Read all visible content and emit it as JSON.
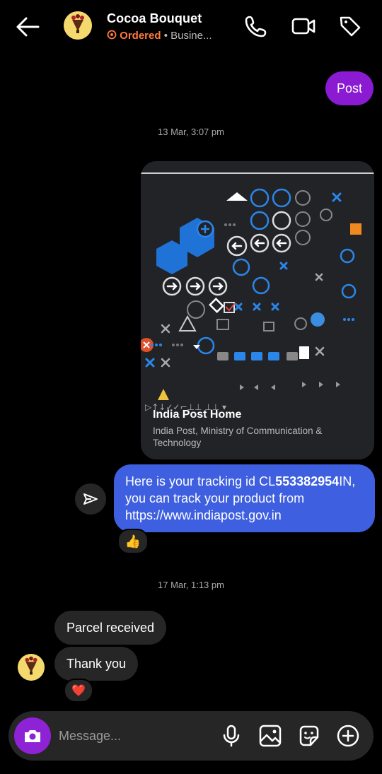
{
  "header": {
    "title": "Cocoa Bouquet",
    "status": "Ordered",
    "category": "• Busine..."
  },
  "messages": {
    "post_label": "Post",
    "timestamp_1": "13 Mar, 3:07 pm",
    "link_card": {
      "title": "India Post Home",
      "description": "India Post, Ministry of Communication & Technology"
    },
    "tracking": {
      "prefix": "Here is your tracking id CL",
      "number": "553382954",
      "suffix": "IN, you can track your product from https://www.indiapost.gov.in"
    },
    "reaction_1": "👍",
    "timestamp_2": "17 Mar, 1:13 pm",
    "received_1": "Parcel received",
    "received_2": "Thank you",
    "reaction_2": "❤️"
  },
  "composer": {
    "placeholder": "Message..."
  },
  "colors": {
    "accent_purple": "#8a1bd2",
    "sent_blue": "#3e5fe0",
    "ordered_orange": "#ff7a3d"
  }
}
